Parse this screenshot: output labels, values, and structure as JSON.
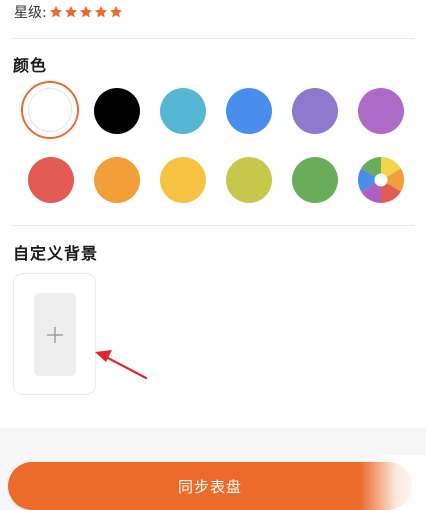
{
  "rating": {
    "label": "星级:",
    "stars": 5,
    "star_color": "#ec6b2b"
  },
  "color_section": {
    "title": "颜色",
    "selected": "white",
    "swatches": [
      {
        "name": "white",
        "hex": "#ffffff"
      },
      {
        "name": "black",
        "hex": "#000000"
      },
      {
        "name": "cyan",
        "hex": "#56b7d4"
      },
      {
        "name": "blue",
        "hex": "#4a8eec"
      },
      {
        "name": "lavender",
        "hex": "#8e7acc"
      },
      {
        "name": "purple",
        "hex": "#ad6ac6"
      },
      {
        "name": "red",
        "hex": "#e35b54"
      },
      {
        "name": "orange",
        "hex": "#f29f3a"
      },
      {
        "name": "yellow",
        "hex": "#f5c242"
      },
      {
        "name": "lime",
        "hex": "#c6c84c"
      },
      {
        "name": "green",
        "hex": "#69ad5b"
      },
      {
        "name": "custom-color-wheel",
        "hex": "multicolor"
      }
    ]
  },
  "custom_background": {
    "title": "自定义背景",
    "add_icon": "plus-icon"
  },
  "sync_button": {
    "label": "同步表盘",
    "color": "#ec6b2b"
  }
}
